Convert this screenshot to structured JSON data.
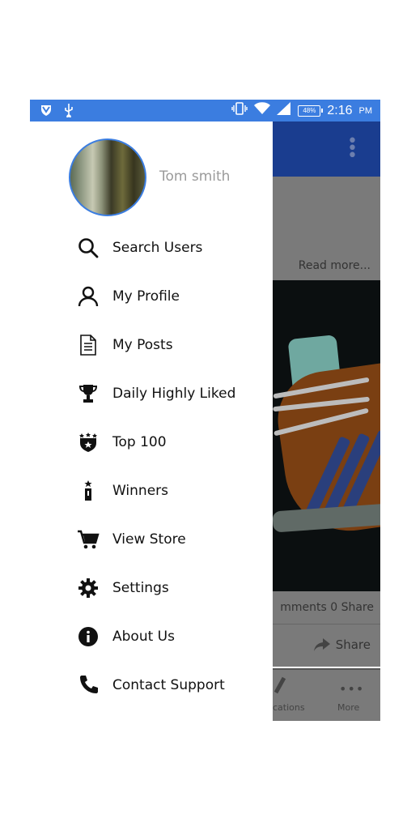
{
  "status_bar": {
    "time": "2:16",
    "ampm": "PM",
    "battery": "48%"
  },
  "user": {
    "name": "Tom smith"
  },
  "drawer_menu": [
    {
      "label": "Search Users",
      "icon": "search-icon"
    },
    {
      "label": "My Profile",
      "icon": "user-icon"
    },
    {
      "label": "My Posts",
      "icon": "document-icon"
    },
    {
      "label": "Daily Highly Liked",
      "icon": "trophy-icon"
    },
    {
      "label": "Top 100",
      "icon": "star-badge-icon"
    },
    {
      "label": "Winners",
      "icon": "winner-icon"
    },
    {
      "label": "View Store",
      "icon": "cart-icon"
    },
    {
      "label": "Settings",
      "icon": "gear-icon"
    },
    {
      "label": "About Us",
      "icon": "info-icon"
    },
    {
      "label": "Contact Support",
      "icon": "phone-icon"
    }
  ],
  "background_app": {
    "read_more": "Read more...",
    "stats": "mments   0 Share",
    "share_label": "Share",
    "nav_cut_label": "cations",
    "nav_more_label": "More"
  },
  "colors": {
    "accent": "#3b7de0",
    "header_dark": "#1a3d8f"
  }
}
